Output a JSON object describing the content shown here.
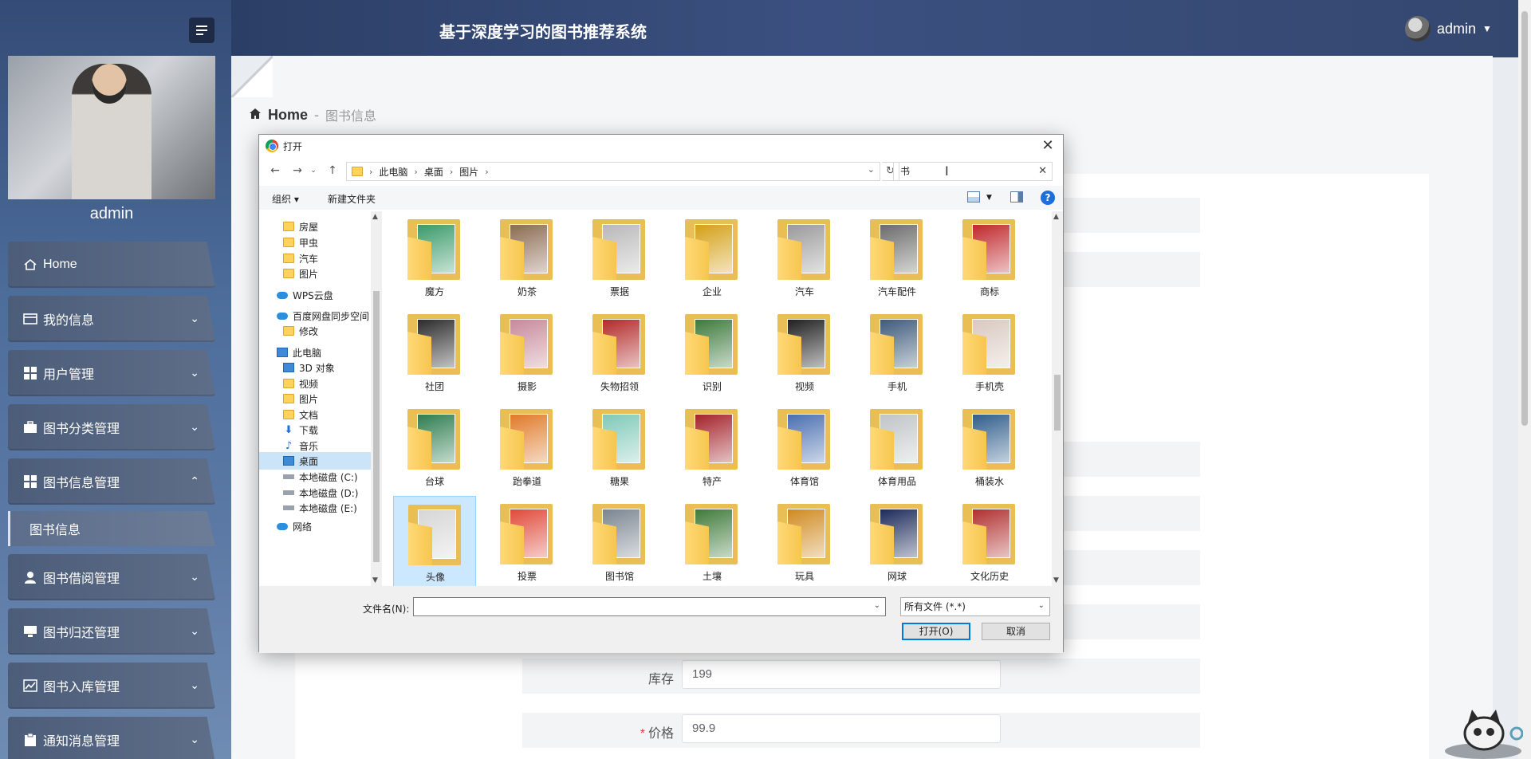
{
  "header": {
    "app_title": "基于深度学习的图书推荐系统",
    "user_name": "admin"
  },
  "sidebar": {
    "profile_name": "admin",
    "items": [
      {
        "label": "Home",
        "icon": "home-icon"
      },
      {
        "label": "我的信息",
        "icon": "id-card-icon"
      },
      {
        "label": "用户管理",
        "icon": "grid-icon"
      },
      {
        "label": "图书分类管理",
        "icon": "briefcase-icon"
      },
      {
        "label": "图书信息管理",
        "icon": "grid-icon"
      },
      {
        "label": "图书借阅管理",
        "icon": "user-icon"
      },
      {
        "label": "图书归还管理",
        "icon": "monitor-icon"
      },
      {
        "label": "图书入库管理",
        "icon": "chart-icon"
      },
      {
        "label": "通知消息管理",
        "icon": "clipboard-icon"
      }
    ],
    "active_sub": "图书信息"
  },
  "breadcrumb": {
    "home": "Home",
    "separator": "-",
    "current": "图书信息"
  },
  "form": {
    "stock_label": "库存",
    "stock_value": "199",
    "price_label": "价格",
    "price_required": "*",
    "price_value": "99.9"
  },
  "dialog": {
    "title": "打开",
    "path": [
      "此电脑",
      "桌面",
      "图片"
    ],
    "search_value": "书",
    "toolbar": {
      "organize": "组织 ▾",
      "new_folder": "新建文件夹"
    },
    "nav_pane": [
      {
        "label": "房屋",
        "icon": "folder-icon",
        "indent": 1
      },
      {
        "label": "甲虫",
        "icon": "folder-icon",
        "indent": 1
      },
      {
        "label": "汽车",
        "icon": "folder-icon",
        "indent": 1
      },
      {
        "label": "图片",
        "icon": "folder-icon",
        "indent": 1
      },
      {
        "label": "WPS云盘",
        "icon": "cloud-icon",
        "indent": 0
      },
      {
        "label": "百度网盘同步空间",
        "icon": "baidu-icon",
        "indent": 0
      },
      {
        "label": "修改",
        "icon": "folder-icon",
        "indent": 1
      },
      {
        "label": "此电脑",
        "icon": "computer-icon",
        "indent": 0
      },
      {
        "label": "3D 对象",
        "icon": "cube-icon",
        "indent": 1
      },
      {
        "label": "视频",
        "icon": "video-icon",
        "indent": 1
      },
      {
        "label": "图片",
        "icon": "picture-icon",
        "indent": 1
      },
      {
        "label": "文档",
        "icon": "document-icon",
        "indent": 1
      },
      {
        "label": "下载",
        "icon": "download-icon",
        "indent": 1
      },
      {
        "label": "音乐",
        "icon": "music-icon",
        "indent": 1
      },
      {
        "label": "桌面",
        "icon": "desktop-icon",
        "indent": 1,
        "selected": true
      },
      {
        "label": "本地磁盘 (C:)",
        "icon": "drive-icon",
        "indent": 1
      },
      {
        "label": "本地磁盘 (D:)",
        "icon": "drive-icon",
        "indent": 1
      },
      {
        "label": "本地磁盘 (E:)",
        "icon": "drive-icon",
        "indent": 1
      },
      {
        "label": "网络",
        "icon": "network-icon",
        "indent": 0
      }
    ],
    "folders": [
      {
        "name": "魔方",
        "color": "#3a9a6a"
      },
      {
        "name": "奶茶",
        "color": "#8b6b52"
      },
      {
        "name": "票据",
        "color": "#b8b8b8"
      },
      {
        "name": "企业",
        "color": "#d4a017"
      },
      {
        "name": "汽车",
        "color": "#9a9a9a"
      },
      {
        "name": "汽车配件",
        "color": "#6b6b6b"
      },
      {
        "name": "商标",
        "color": "#c0282d"
      },
      {
        "name": "社团",
        "color": "#2b2b2b"
      },
      {
        "name": "摄影",
        "color": "#c7889a"
      },
      {
        "name": "失物招领",
        "color": "#b22a2a"
      },
      {
        "name": "识别",
        "color": "#3d7a3d"
      },
      {
        "name": "视频",
        "color": "#1f1f1f"
      },
      {
        "name": "手机",
        "color": "#3d5a7a"
      },
      {
        "name": "手机壳",
        "color": "#d9c8c0"
      },
      {
        "name": "台球",
        "color": "#2e7d4f"
      },
      {
        "name": "跆拳道",
        "color": "#e07a2a"
      },
      {
        "name": "糖果",
        "color": "#7fc9b8"
      },
      {
        "name": "特产",
        "color": "#a3232a"
      },
      {
        "name": "体育馆",
        "color": "#4a6fb0"
      },
      {
        "name": "体育用品",
        "color": "#c0c4c8"
      },
      {
        "name": "桶装水",
        "color": "#2f5d8a"
      },
      {
        "name": "头像",
        "color": "#d6d6d6",
        "selected": true
      },
      {
        "name": "投票",
        "color": "#e04a3a"
      },
      {
        "name": "图书馆",
        "color": "#7a8590"
      },
      {
        "name": "土壤",
        "color": "#3f7a3a"
      },
      {
        "name": "玩具",
        "color": "#d08a20"
      },
      {
        "name": "网球",
        "color": "#1c2a5a"
      },
      {
        "name": "文化历史",
        "color": "#b03030"
      }
    ],
    "filename_label": "文件名(N):",
    "filename_value": "",
    "filetype": "所有文件 (*.*)",
    "open_button": "打开(O)",
    "cancel_button": "取消"
  }
}
